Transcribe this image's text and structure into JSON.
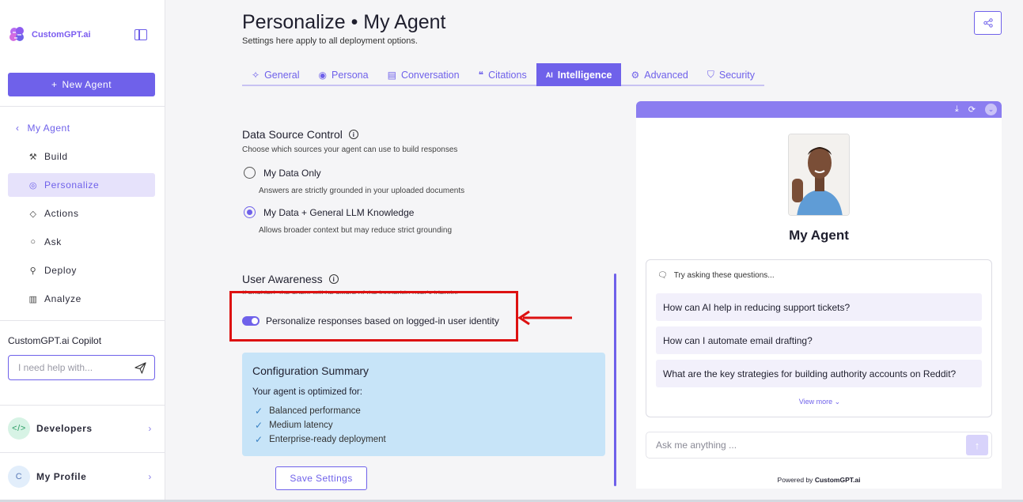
{
  "brand": {
    "name": "CustomGPT.ai"
  },
  "sidebar": {
    "new_agent_label": "New Agent",
    "back_label": "My Agent",
    "items": [
      {
        "label": "Build",
        "icon": "build-icon"
      },
      {
        "label": "Personalize",
        "icon": "palette-icon",
        "active": true
      },
      {
        "label": "Actions",
        "icon": "diamond-icon"
      },
      {
        "label": "Ask",
        "icon": "chat-icon"
      },
      {
        "label": "Deploy",
        "icon": "rocket-icon"
      },
      {
        "label": "Analyze",
        "icon": "bar-chart-icon"
      }
    ],
    "copilot_title": "CustomGPT.ai Copilot",
    "copilot_placeholder": "I need help with...",
    "developers_label": "Developers",
    "profile_label": "My Profile",
    "profile_initial": "C"
  },
  "header": {
    "title": "Personalize • My Agent",
    "subtitle": "Settings here apply to all deployment options."
  },
  "tabs": [
    {
      "label": "General",
      "icon": "wand-icon"
    },
    {
      "label": "Persona",
      "icon": "user-circle-icon"
    },
    {
      "label": "Conversation",
      "icon": "message-icon"
    },
    {
      "label": "Citations",
      "icon": "quote-icon"
    },
    {
      "label": "Intelligence",
      "icon": "ai-icon",
      "active": true
    },
    {
      "label": "Advanced",
      "icon": "wrench-icon"
    },
    {
      "label": "Security",
      "icon": "shield-icon"
    }
  ],
  "data_source": {
    "title": "Data Source Control",
    "description": "Choose which sources your agent can use to build responses",
    "options": [
      {
        "label": "My Data Only",
        "hint": "Answers are strictly grounded in your uploaded documents",
        "checked": false
      },
      {
        "label": "My Data + General LLM Knowledge",
        "hint": "Allows broader context but may reduce strict grounding",
        "checked": true
      }
    ]
  },
  "user_awareness": {
    "title": "User Awareness",
    "description": "If enabled, the agent will be aware of the logged-in user's identity",
    "toggle_label": "Personalize responses based on logged-in user identity",
    "toggle_on": true
  },
  "config_summary": {
    "title": "Configuration Summary",
    "subtitle": "Your agent is optimized for:",
    "items": [
      "Balanced performance",
      "Medium latency",
      "Enterprise-ready deployment"
    ]
  },
  "save_label": "Save Settings",
  "preview": {
    "agent_name": "My Agent",
    "questions_header": "Try asking these questions...",
    "questions": [
      "How can AI help in reducing support tickets?",
      "How can I automate email drafting?",
      "What are the key strategies for building authority accounts on Reddit?"
    ],
    "view_more": "View more",
    "ask_placeholder": "Ask me anything ...",
    "powered_prefix": "Powered by",
    "powered_brand": "CustomGPT.ai"
  },
  "colors": {
    "accent": "#6f61ea",
    "highlight": "#dd1111",
    "summary_bg": "#c7e4f8"
  }
}
